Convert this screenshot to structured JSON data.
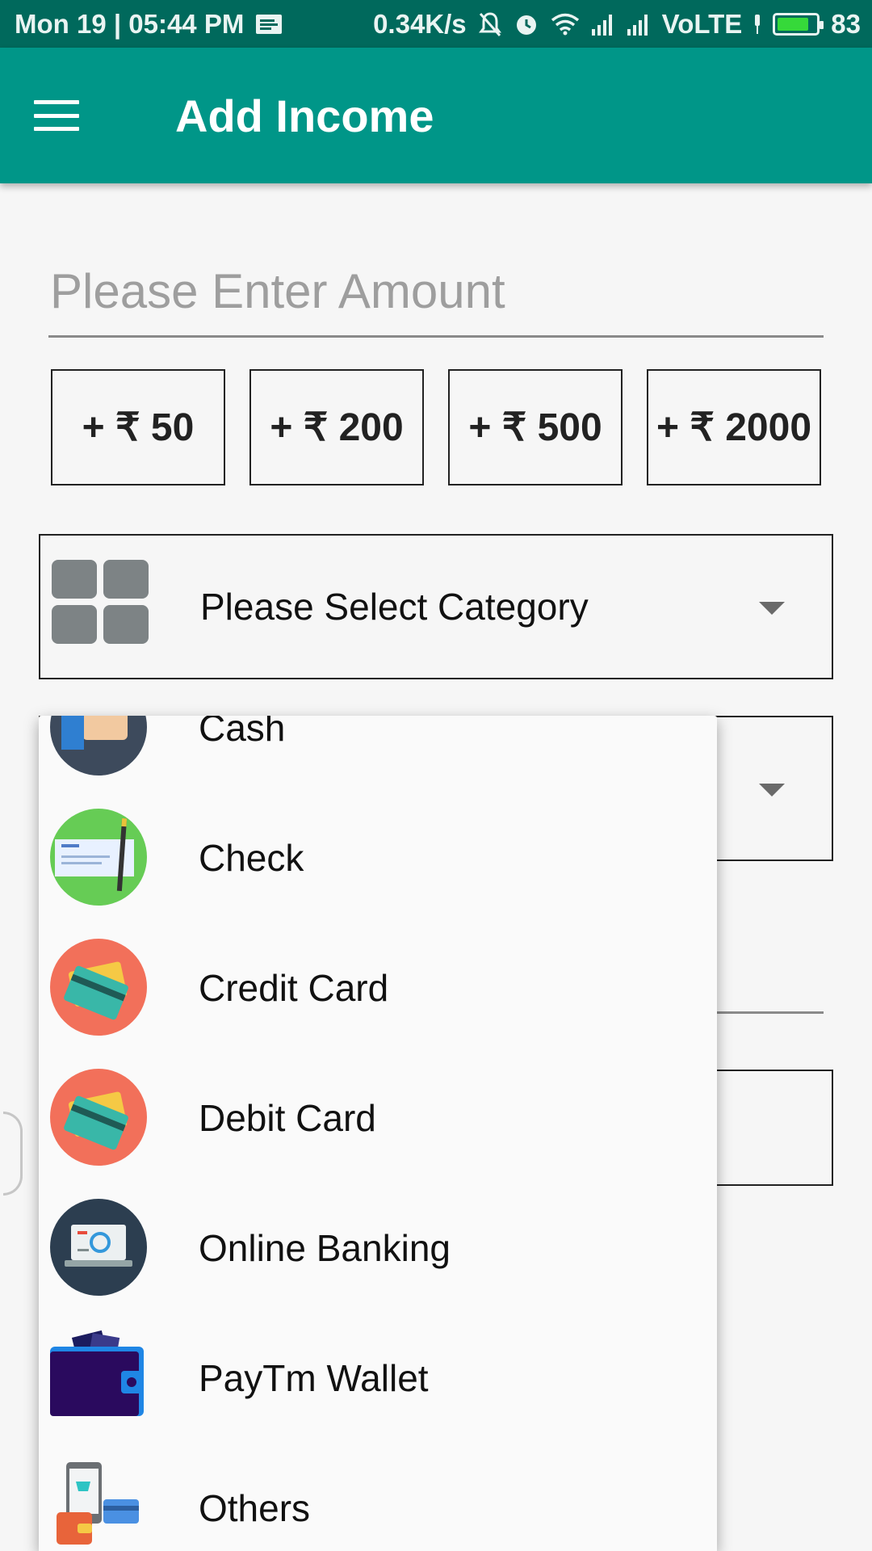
{
  "status_bar": {
    "time": "Mon 19 | 05:44 PM",
    "speed": "0.34K/s",
    "network": "VoLTE",
    "battery": "83",
    "battery_level": 0.83
  },
  "app_bar": {
    "title": "Add Income",
    "menu_icon": "hamburger-menu-icon"
  },
  "amount": {
    "placeholder": "Please Enter Amount",
    "value": ""
  },
  "quick_amounts": [
    "+ ₹ 50",
    "+ ₹ 200",
    "+ ₹ 500",
    "+ ₹ 2000"
  ],
  "category": {
    "label": "Please Select Category",
    "icon": "category-grid-icon"
  },
  "payment_dropdown": {
    "items": [
      {
        "label": "Cash",
        "icon": "cash-hand-icon"
      },
      {
        "label": "Check",
        "icon": "bank-check-icon"
      },
      {
        "label": "Credit Card",
        "icon": "credit-card-icon"
      },
      {
        "label": "Debit Card",
        "icon": "debit-card-icon"
      },
      {
        "label": "Online Banking",
        "icon": "online-banking-laptop-icon"
      },
      {
        "label": "PayTm Wallet",
        "icon": "wallet-icon"
      },
      {
        "label": "Others",
        "icon": "others-shopping-icon"
      }
    ]
  },
  "colors": {
    "primary": "#009688",
    "primary_dark": "#00695c",
    "battery_fill": "#36d93a"
  }
}
